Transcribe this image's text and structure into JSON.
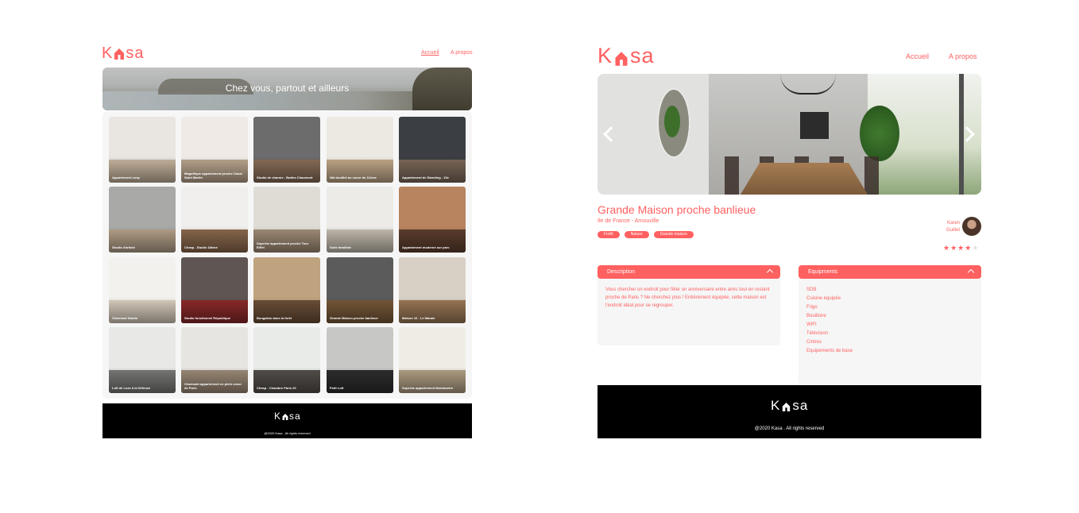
{
  "brand": {
    "logo_left": "K",
    "logo_right": "sa",
    "accent_color": "#FF6060"
  },
  "home": {
    "nav": {
      "accueil": "Accueil",
      "apropos": "A propos"
    },
    "banner_text": "Chez vous, partout et ailleurs",
    "cards": [
      {
        "title": "Appartement cosy"
      },
      {
        "title": "Magnifique appartement proche Canal Saint Martin"
      },
      {
        "title": "Studio de charme - Buttes Chaumont"
      },
      {
        "title": "Nid douillet au coeur du 11ème"
      },
      {
        "title": "Appartement de Standing - 10e"
      },
      {
        "title": "Studio d'artiste"
      },
      {
        "title": "Cheap - Studio 18ème"
      },
      {
        "title": "Superbe appartement proche Tour Eiffel"
      },
      {
        "title": "Suite familiale"
      },
      {
        "title": "Appartement moderne sur parc"
      },
      {
        "title": "Charmant Studio"
      },
      {
        "title": "Studio fonctionnel République"
      },
      {
        "title": "Bungalow dans la forêt"
      },
      {
        "title": "Grande Maison proche banlieue"
      },
      {
        "title": "Maison 10 - Le Marais"
      },
      {
        "title": "Loft de Luxe à la Défense"
      },
      {
        "title": "Charmant appartement en plein coeur de Paris"
      },
      {
        "title": "Cheap - Chambre Paris 20"
      },
      {
        "title": "Petit Loft"
      },
      {
        "title": "Superbe appartement Montmartre"
      }
    ],
    "footer": {
      "copyright": "@2020 Kasa . All rights reserved"
    }
  },
  "lodging": {
    "nav": {
      "accueil": "Accueil",
      "apropos": "A propos"
    },
    "title": "Grande Maison proche banlieue",
    "location": "Ile de France - Arnouville",
    "tags": [
      "Forêt",
      "Nature",
      "Grande maison"
    ],
    "host": {
      "first_name": "Karen",
      "last_name": "Guillet"
    },
    "rating": 4,
    "rating_max": 5,
    "description": {
      "header": "Description",
      "text": "Vous chercher un endroit pour fêter un anniversaire entre amis tout en restant proche de Paris ? Ne cherchez plus ! Entièrement équipée, cette maison est l'endroit idéal pour se regrouper."
    },
    "equipments": {
      "header": "Equipments",
      "items": [
        "SDB",
        "Cuisine équipée",
        "Frigo",
        "Bouilloire",
        "WIFI",
        "Télévision",
        "Cintres",
        "Equipements de base"
      ]
    },
    "footer": {
      "copyright": "@2020 Kasa . All rights reserved"
    }
  }
}
